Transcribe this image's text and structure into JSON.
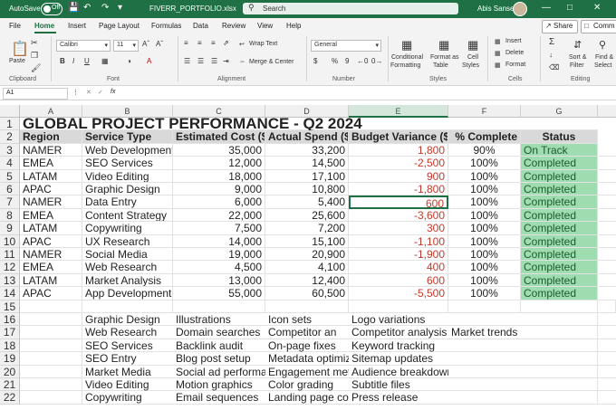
{
  "titlebar": {
    "autosave_label": "AutoSave",
    "autosave_state": "Off",
    "file_name": "FIVERR_PORTFOLIO.xlsx",
    "search_placeholder": "Search",
    "user_name": "Abis Sanse"
  },
  "menu": {
    "items": [
      "File",
      "Home",
      "Insert",
      "Page Layout",
      "Formulas",
      "Data",
      "Review",
      "View",
      "Help"
    ],
    "active": "Home",
    "share_label": "Share",
    "comments_label": "Comm"
  },
  "ribbon": {
    "paste": "Paste",
    "font_name": "Calibri",
    "font_size": "11",
    "wrap_text": "Wrap Text",
    "merge_center": "Merge & Center",
    "number_format": "General",
    "conditional_formatting": [
      "Conditional",
      "Formatting"
    ],
    "format_as_table": [
      "Format as",
      "Table"
    ],
    "cell_styles": [
      "Cell",
      "Styles"
    ],
    "insert": "Insert",
    "delete": "Delete",
    "format": "Format",
    "sort_filter": [
      "Sort &",
      "Filter"
    ],
    "find_select": [
      "Find &",
      "Select"
    ],
    "groups": [
      "Clipboard",
      "Font",
      "Alignment",
      "Number",
      "Styles",
      "Cells",
      "Editing"
    ],
    "accent_color": "#1f7145"
  },
  "formula_bar": {
    "name_box": "A1",
    "fx": "fx",
    "value": ""
  },
  "sheet": {
    "columns": [
      "A",
      "B",
      "C",
      "D",
      "E",
      "F",
      "G"
    ],
    "selected_column": "E",
    "title": "GLOBAL PROJECT PERFORMANCE - Q2 2024",
    "headers": [
      "Region",
      "Service Type",
      "Estimated Cost ($)",
      "Actual Spend ($)",
      "Budget Variance ($)",
      "% Complete",
      "Status"
    ],
    "rows": [
      [
        "NAMER",
        "Web Development",
        "35,000",
        "33,200",
        "1,800",
        "90%",
        "On Track"
      ],
      [
        "EMEA",
        "SEO Services",
        "12,000",
        "14,500",
        "-2,500",
        "100%",
        "Completed"
      ],
      [
        "LATAM",
        "Video Editing",
        "18,000",
        "17,100",
        "900",
        "100%",
        "Completed"
      ],
      [
        "APAC",
        "Graphic Design",
        "9,000",
        "10,800",
        "-1,800",
        "100%",
        "Completed"
      ],
      [
        "NAMER",
        "Data Entry",
        "6,000",
        "5,400",
        "600",
        "100%",
        "Completed"
      ],
      [
        "EMEA",
        "Content Strategy",
        "22,000",
        "25,600",
        "-3,600",
        "100%",
        "Completed"
      ],
      [
        "LATAM",
        "Copywriting",
        "7,500",
        "7,200",
        "300",
        "100%",
        "Completed"
      ],
      [
        "APAC",
        "UX Research",
        "14,000",
        "15,100",
        "-1,100",
        "100%",
        "Completed"
      ],
      [
        "NAMER",
        "Social Media",
        "19,000",
        "20,900",
        "-1,900",
        "100%",
        "Completed"
      ],
      [
        "EMEA",
        "Web Research",
        "4,500",
        "4,100",
        "400",
        "100%",
        "Completed"
      ],
      [
        "LATAM",
        "Market Analysis",
        "13,000",
        "12,400",
        "600",
        "100%",
        "Completed"
      ],
      [
        "APAC",
        "App Development",
        "55,000",
        "60,500",
        "-5,500",
        "100%",
        "Completed"
      ]
    ],
    "lower_rows": [
      [
        "Graphic Design",
        "Illustrations",
        "Icon sets",
        "Logo variations",
        ""
      ],
      [
        "Web Research",
        "Domain searches",
        "Competitor an",
        "Competitor analysis",
        "Market trends"
      ],
      [
        "SEO Services",
        "Backlink audit",
        "On-page fixes",
        "Keyword tracking",
        ""
      ],
      [
        "SEO Entry",
        "Blog post setup",
        "Metadata optimization",
        "Sitemap updates",
        ""
      ],
      [
        "Market Media",
        "Social ad performance",
        "Engagement metri",
        "Audience breakdown",
        ""
      ],
      [
        "Video Editing",
        "Motion graphics",
        "Color grading",
        "Subtitle files",
        ""
      ],
      [
        "Copywriting",
        "Email sequences",
        "Landing page copy",
        "Press release",
        ""
      ]
    ],
    "row_numbers": [
      "1",
      "2",
      "3",
      "4",
      "5",
      "6",
      "7",
      "8",
      "9",
      "10",
      "11",
      "12",
      "13",
      "14",
      "15",
      "16",
      "17",
      "18",
      "19",
      "20",
      "21",
      "22"
    ],
    "status_color": "#9fdcb0",
    "negative_color": "#c0392b"
  }
}
